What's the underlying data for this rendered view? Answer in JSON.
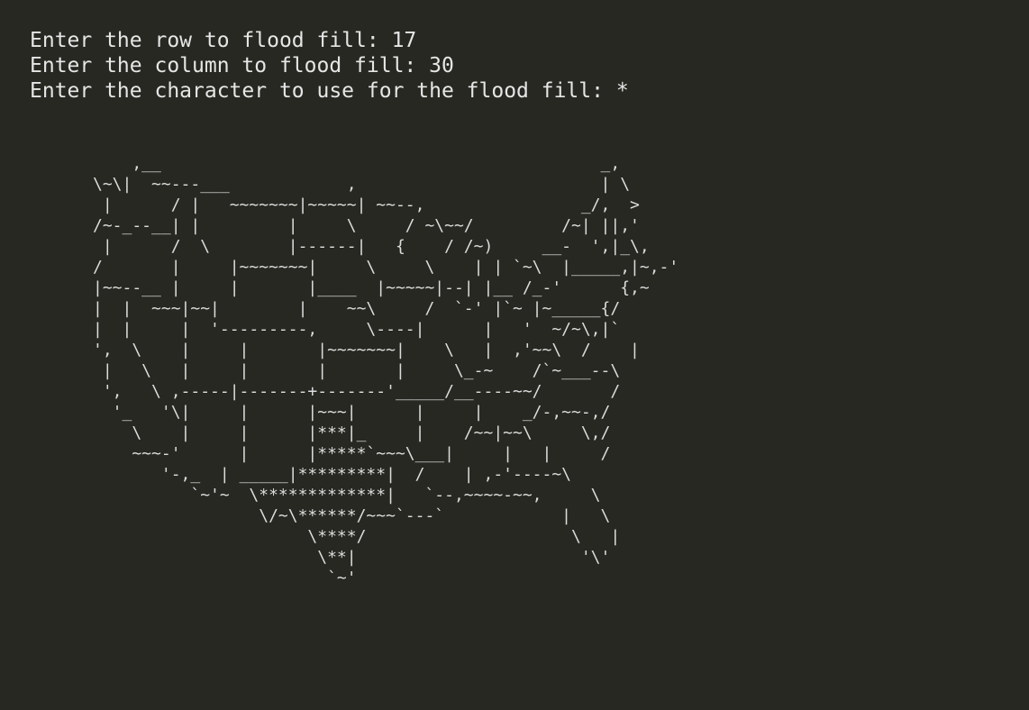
{
  "prompts": [
    "Enter the row to flood fill: 17",
    "Enter the column to flood fill: 30",
    "Enter the character to use for the flood fill: *"
  ],
  "map_lines": [
    "    ,__                                             _,",
    "\\~\\|  ~~---___            ,                         | \\",
    " |      / |   ~~~~~~~|~~~~~| ~~--,                _/,  >",
    "/~-_--__| |         |     \\     / ~\\~~/         /~| ||,'",
    " |      /  \\        |------|   {    / /~)     __-  ',|_\\,",
    "/       |     |~~~~~~~|     \\     \\    | | `~\\  |_____,|~,-'",
    "|~~--__ |     |       |____  |~~~~~|--| |__ /_-'      {,~",
    "|  |  ~~~|~~|        |    ~~\\     /  `-' |`~ |~_____{/",
    "|  |     |  '---------,     \\----|      |   '  ~/~\\,|`",
    "',  \\    |     |       |~~~~~~~|    \\   |  ,'~~\\  /    |",
    " |   \\   |     |       |       |     \\_-~    /`~___--\\",
    " ',   \\ ,-----|-------+-------'_____/__----~~/       /",
    "  '_   '\\|     |      |~~~|      |     |    _/-,~~-,/",
    "    \\    |     |      |***|_     |    /~~|~~\\     \\,/",
    "    ~~~-'      |      |*****`~~~\\___|     |   |     /",
    "       '-,_  | _____|*********|  /    | ,-'----~\\",
    "          `~'~  \\*************|   `--,~~~~-~~,     \\",
    "                 \\/~\\******/~~~`---`            |   \\",
    "                      \\****/                     \\   |",
    "                       \\**|                       '\\'",
    "                        `~'"
  ]
}
